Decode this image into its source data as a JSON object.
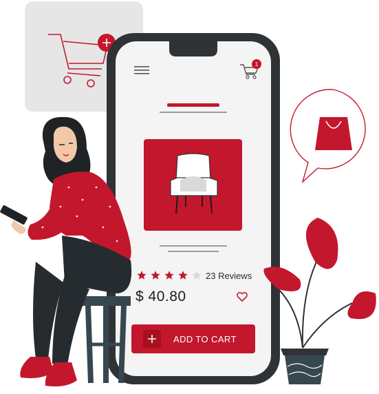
{
  "product": {
    "rating": 4,
    "rating_max": 5,
    "reviews_text": "23 Reviews",
    "price": "$ 40.80"
  },
  "cart": {
    "badge_count": "1",
    "button_label": "ADD TO CART"
  },
  "colors": {
    "accent": "#c3172d",
    "phone_frame": "#2f3336",
    "screen_bg": "#f4f4f4",
    "star_empty": "#d9d9d9"
  },
  "icons": [
    "hamburger-menu-icon",
    "cart-icon",
    "chair-icon",
    "star-icon",
    "heart-icon",
    "plus-icon",
    "shopping-bag-icon"
  ]
}
